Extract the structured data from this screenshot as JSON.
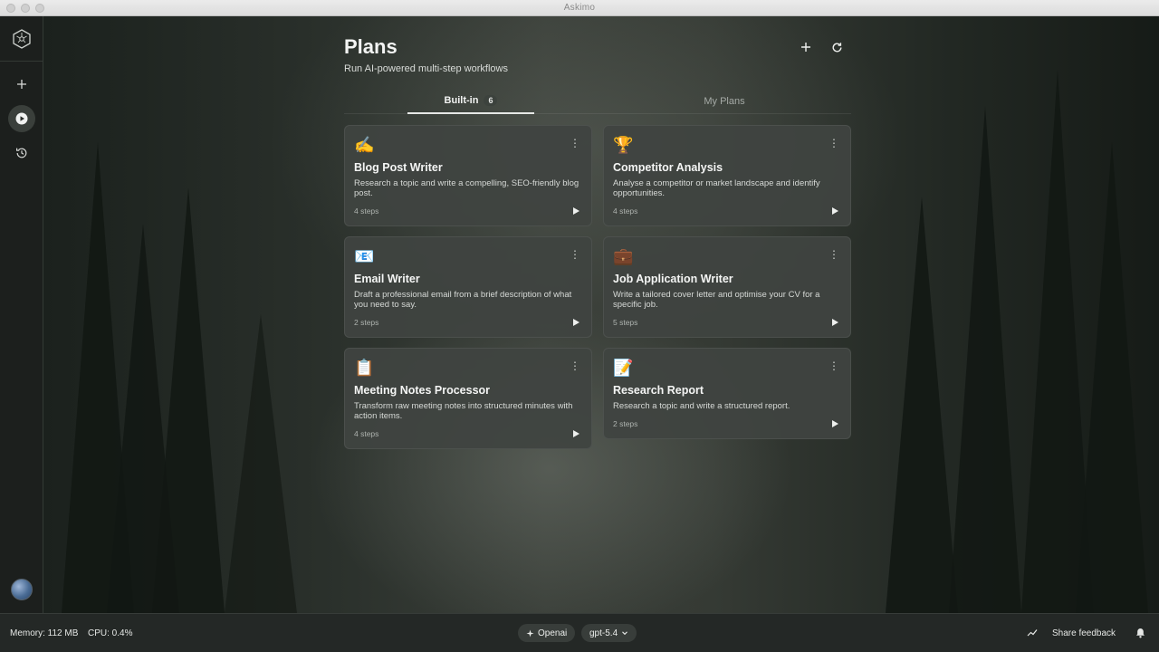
{
  "window": {
    "title": "Askimo"
  },
  "header": {
    "title": "Plans",
    "subtitle": "Run AI-powered multi-step workflows",
    "add_icon": "plus-icon",
    "refresh_icon": "refresh-icon"
  },
  "tabs": [
    {
      "label": "Built-in",
      "count": "6",
      "active": true
    },
    {
      "label": "My Plans",
      "active": false
    }
  ],
  "plans": [
    {
      "emoji": "✍️",
      "name": "Blog Post Writer",
      "description": "Research a topic and write a compelling, SEO-friendly blog post.",
      "steps": "4 steps"
    },
    {
      "emoji": "🏆",
      "name": "Competitor Analysis",
      "description": "Analyse a competitor or market landscape and identify opportunities.",
      "steps": "4 steps"
    },
    {
      "emoji": "📧",
      "name": "Email Writer",
      "description": "Draft a professional email from a brief description of what you need to say.",
      "steps": "2 steps"
    },
    {
      "emoji": "💼",
      "name": "Job Application Writer",
      "description": "Write a tailored cover letter and optimise your CV for a specific job.",
      "steps": "5 steps"
    },
    {
      "emoji": "📋",
      "name": "Meeting Notes Processor",
      "description": "Transform raw meeting notes into structured minutes with action items.",
      "steps": "4 steps"
    },
    {
      "emoji": "📝",
      "name": "Research Report",
      "description": "Research a topic and write a structured report.",
      "steps": "2 steps"
    }
  ],
  "sidebar": {
    "items": [
      {
        "icon": "plus-icon"
      },
      {
        "icon": "play-icon",
        "active": true
      },
      {
        "icon": "history-icon"
      }
    ]
  },
  "status": {
    "memory": "Memory: 112 MB",
    "cpu": "CPU: 0.4%",
    "provider": "Openai",
    "model": "gpt-5.4",
    "feedback": "Share feedback"
  }
}
